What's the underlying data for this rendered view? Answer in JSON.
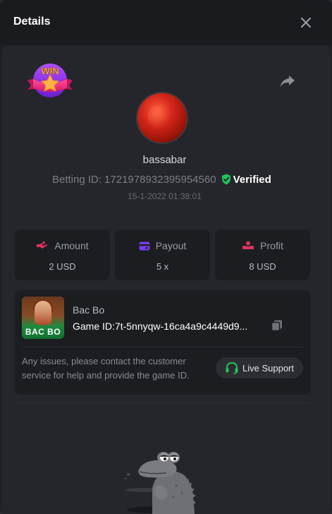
{
  "header": {
    "title": "Details"
  },
  "icons": {
    "close": "close-icon",
    "share": "share-icon",
    "verified": "shield-check-icon",
    "copy": "copy-icon",
    "headset": "headset-icon"
  },
  "badge": {
    "text": "WIN"
  },
  "player": {
    "username": "bassabar",
    "betting_label": "Betting ID:",
    "betting_id": "1721978932395954560",
    "verified_label": "Verified",
    "datetime": "15-1-2022 01:38:01"
  },
  "stats": [
    {
      "label": "Amount",
      "value": "2 USD",
      "color": "#e0355a"
    },
    {
      "label": "Payout",
      "value": "5 x",
      "color": "#7a3cf0"
    },
    {
      "label": "Profit",
      "value": "8 USD",
      "color": "#e0355a"
    }
  ],
  "game": {
    "thumb_label": "BAC BO",
    "name": "Bac Bo",
    "id_label": "Game ID:",
    "id_value": "7t-5nnyqw-16ca4a9c4449d9...",
    "help_text": "Any issues, please contact the customer service for help and provide the game ID.",
    "support_label": "Live Support"
  },
  "colors": {
    "accent_green": "#22c55e",
    "verified_green": "#1fc25a",
    "panel_bg": "#25262b",
    "card_bg": "#1c1d21"
  }
}
